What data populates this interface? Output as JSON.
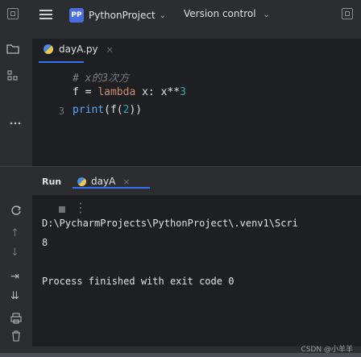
{
  "topbar": {
    "project_badge": "PP",
    "project_name": "PythonProject",
    "project_chevron": "⌄",
    "vcs_label": "Version control",
    "vcs_chevron": "⌄"
  },
  "editor": {
    "tab_label": "dayA.py",
    "tab_close": "×",
    "lines": [
      {
        "num": "",
        "text": "# x的3次方"
      },
      {
        "num": "",
        "text": "f = lambda x: x**3"
      },
      {
        "num": "3",
        "text": "print(f(2))"
      }
    ]
  },
  "run": {
    "label": "Run",
    "tab_label": "dayA",
    "tab_close": "×",
    "output": [
      "D:\\PycharmProjects\\PythonProject\\.venv1\\Scri",
      "8",
      "",
      "Process finished with exit code 0"
    ]
  },
  "watermark": "CSDN @小羊羊",
  "colors": {
    "accent": "#3574f0",
    "keyword": "#cf8e6d",
    "function": "#56a8f5",
    "number": "#2aacb8"
  }
}
